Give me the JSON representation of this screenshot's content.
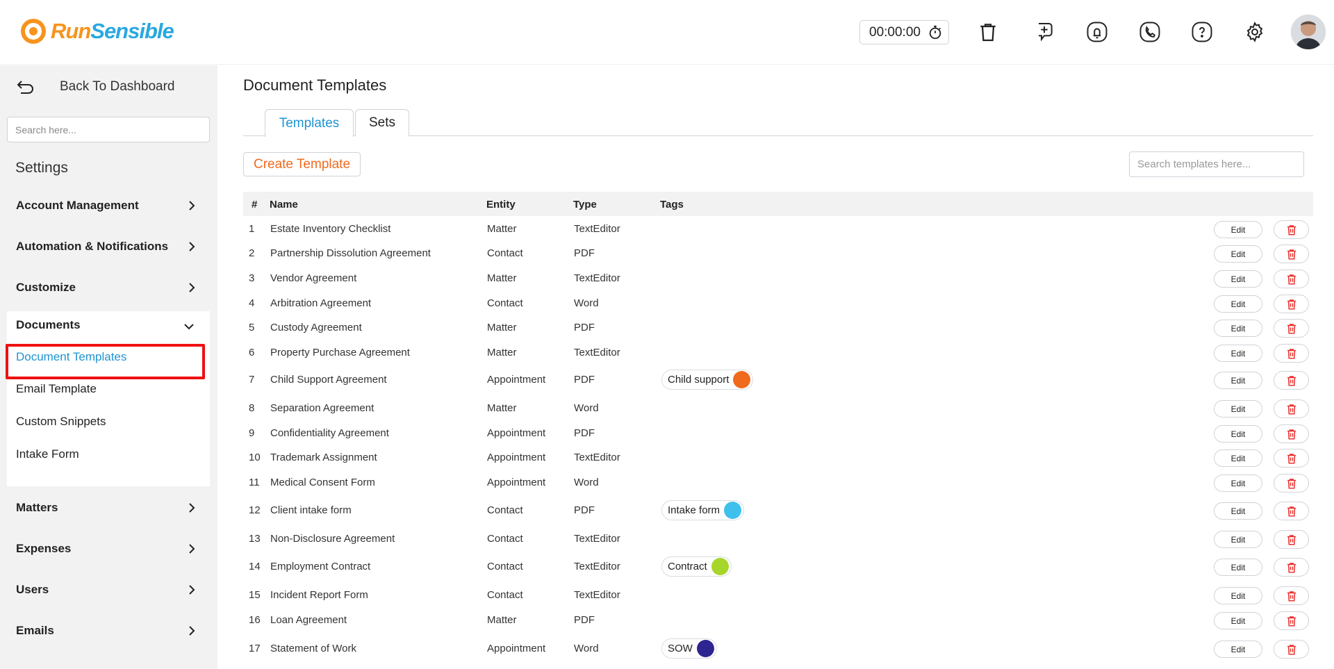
{
  "header": {
    "logo_run": "Run",
    "logo_sensible": "Sensible",
    "timer": "00:00:00",
    "icons": [
      "stopwatch-icon",
      "trash-icon",
      "add-task-icon",
      "bell-icon",
      "phone-icon",
      "help-icon",
      "gear-icon",
      "avatar"
    ]
  },
  "sidebar": {
    "back_label": "Back To Dashboard",
    "search_placeholder": "Search here...",
    "settings_title": "Settings",
    "sections_top": [
      "Account Management",
      "Automation & Notifications",
      "Customize"
    ],
    "documents": {
      "label": "Documents",
      "items": [
        "Document Templates",
        "Email Template",
        "Custom Snippets",
        "Intake Form"
      ],
      "active": "Document Templates"
    },
    "sections_bottom": [
      "Matters",
      "Expenses",
      "Users",
      "Emails"
    ]
  },
  "main": {
    "title": "Document Templates",
    "tabs": [
      "Templates",
      "Sets"
    ],
    "active_tab": "Templates",
    "create_label": "Create Template",
    "search_placeholder": "Search templates here...",
    "columns": [
      "#",
      "Name",
      "Entity",
      "Type",
      "Tags"
    ],
    "edit_label": "Edit",
    "rows": [
      {
        "n": "1",
        "name": "Estate Inventory Checklist",
        "entity": "Matter",
        "type": "TextEditor",
        "tag": null
      },
      {
        "n": "2",
        "name": "Partnership Dissolution Agreement",
        "entity": "Contact",
        "type": "PDF",
        "tag": null
      },
      {
        "n": "3",
        "name": "Vendor Agreement",
        "entity": "Matter",
        "type": "TextEditor",
        "tag": null
      },
      {
        "n": "4",
        "name": "Arbitration Agreement",
        "entity": "Contact",
        "type": "Word",
        "tag": null
      },
      {
        "n": "5",
        "name": "Custody Agreement",
        "entity": "Matter",
        "type": "PDF",
        "tag": null
      },
      {
        "n": "6",
        "name": "Property Purchase Agreement",
        "entity": "Matter",
        "type": "TextEditor",
        "tag": null
      },
      {
        "n": "7",
        "name": "Child Support Agreement",
        "entity": "Appointment",
        "type": "PDF",
        "tag": {
          "label": "Child support",
          "color": "#f06a1e"
        }
      },
      {
        "n": "8",
        "name": "Separation Agreement",
        "entity": "Matter",
        "type": "Word",
        "tag": null
      },
      {
        "n": "9",
        "name": "Confidentiality Agreement",
        "entity": "Appointment",
        "type": "PDF",
        "tag": null
      },
      {
        "n": "10",
        "name": "Trademark Assignment",
        "entity": "Appointment",
        "type": "TextEditor",
        "tag": null
      },
      {
        "n": "11",
        "name": "Medical Consent Form",
        "entity": "Appointment",
        "type": "Word",
        "tag": null
      },
      {
        "n": "12",
        "name": "Client intake form",
        "entity": "Contact",
        "type": "PDF",
        "tag": {
          "label": "Intake form",
          "color": "#3ec0ec"
        }
      },
      {
        "n": "13",
        "name": "Non-Disclosure Agreement",
        "entity": "Contact",
        "type": "TextEditor",
        "tag": null
      },
      {
        "n": "14",
        "name": "Employment Contract",
        "entity": "Contact",
        "type": "TextEditor",
        "tag": {
          "label": "Contract",
          "color": "#a6d62a"
        }
      },
      {
        "n": "15",
        "name": "Incident Report Form",
        "entity": "Contact",
        "type": "TextEditor",
        "tag": null
      },
      {
        "n": "16",
        "name": "Loan Agreement",
        "entity": "Matter",
        "type": "PDF",
        "tag": null
      },
      {
        "n": "17",
        "name": "Statement of Work",
        "entity": "Appointment",
        "type": "Word",
        "tag": {
          "label": "SOW",
          "color": "#2e2591"
        }
      }
    ]
  },
  "colors": {
    "brand_orange": "#f7941d",
    "brand_blue": "#29a8e0",
    "accent_link": "#1f94d2",
    "create_text": "#f06a1e",
    "delete_red": "#e8322f",
    "highlight_red": "#ee1111"
  }
}
